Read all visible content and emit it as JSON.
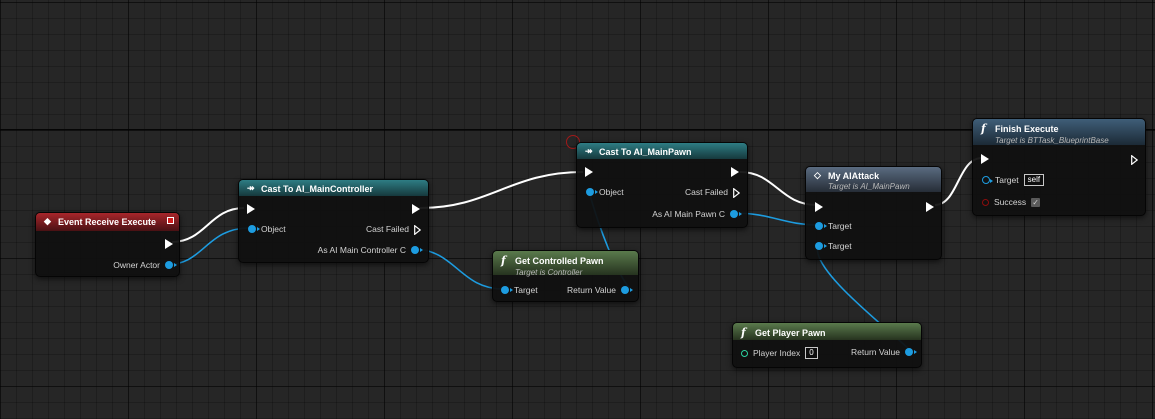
{
  "nodes": {
    "event_receive_execute": {
      "title": "Event Receive Execute",
      "owner_actor_label": "Owner Actor",
      "color": "#a8262b"
    },
    "cast_main_controller": {
      "title": "Cast To AI_MainController",
      "object_label": "Object",
      "cast_failed_label": "Cast Failed",
      "result_label": "As AI Main Controller C"
    },
    "get_controlled_pawn": {
      "title": "Get Controlled Pawn",
      "subtitle": "Target is Controller",
      "target_label": "Target",
      "return_label": "Return Value"
    },
    "cast_main_pawn": {
      "title": "Cast To AI_MainPawn",
      "object_label": "Object",
      "cast_failed_label": "Cast Failed",
      "result_label": "As AI Main Pawn C"
    },
    "my_ai_attack": {
      "title": "My AIAttack",
      "subtitle": "Target is AI_MainPawn",
      "target1_label": "Target",
      "target2_label": "Target"
    },
    "get_player_pawn": {
      "title": "Get Player Pawn",
      "player_index_label": "Player Index",
      "player_index_value": "0",
      "return_label": "Return Value"
    },
    "finish_execute": {
      "title": "Finish Execute",
      "subtitle": "Target is BTTask_BlueprintBase",
      "target_label": "Target",
      "target_value": "self",
      "success_label": "Success",
      "success_checked": true
    }
  },
  "colors": {
    "exec_wire": "#ffffff",
    "object_pin": "#1d9ce0",
    "cast_header": "#2e7d84",
    "function_header": "#5a7a4c",
    "finish_header": "#3f5e78",
    "breakpoint": "#a01a1a"
  }
}
